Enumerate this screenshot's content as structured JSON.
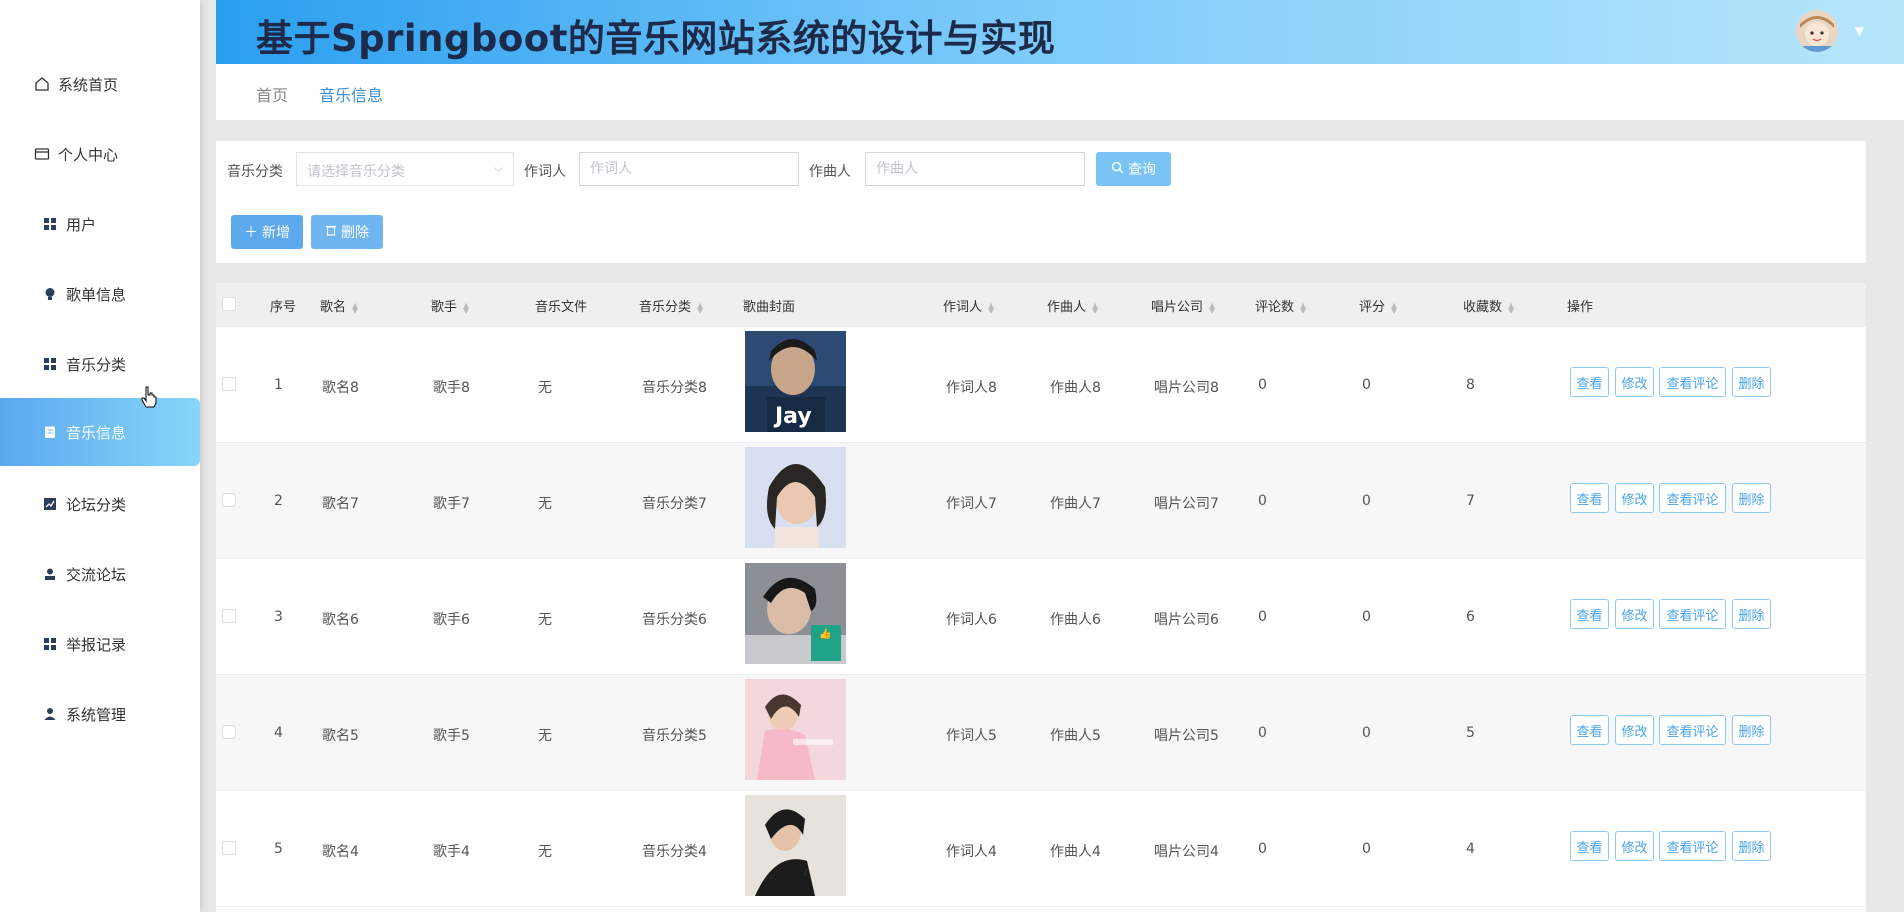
{
  "app": {
    "title": "基于Springboot的音乐网站系统的设计与实现"
  },
  "sidebar": {
    "items": [
      {
        "label": "系统首页",
        "icon": "home-icon"
      },
      {
        "label": "个人中心",
        "icon": "card-icon"
      },
      {
        "label": "用户",
        "icon": "grid-icon"
      },
      {
        "label": "歌单信息",
        "icon": "bulb-icon"
      },
      {
        "label": "音乐分类",
        "icon": "grid-icon"
      },
      {
        "label": "音乐信息",
        "icon": "clipboard-icon",
        "active": true
      },
      {
        "label": "论坛分类",
        "icon": "chart-icon"
      },
      {
        "label": "交流论坛",
        "icon": "user-icon"
      },
      {
        "label": "举报记录",
        "icon": "grid-icon"
      },
      {
        "label": "系统管理",
        "icon": "person-icon"
      }
    ]
  },
  "breadcrumb": {
    "home": "首页",
    "current": "音乐信息"
  },
  "search": {
    "category_label": "音乐分类",
    "category_placeholder": "请选择音乐分类",
    "lyricist_label": "作词人",
    "lyricist_placeholder": "作词人",
    "composer_label": "作曲人",
    "composer_placeholder": "作曲人",
    "search_button": "查询",
    "add_button": "新增",
    "delete_button": "删除"
  },
  "table": {
    "headers": {
      "index": "序号",
      "name": "歌名",
      "singer": "歌手",
      "file": "音乐文件",
      "category": "音乐分类",
      "cover": "歌曲封面",
      "lyricist": "作词人",
      "composer": "作曲人",
      "company": "唱片公司",
      "comments": "评论数",
      "rating": "评分",
      "favorites": "收藏数",
      "ops": "操作"
    },
    "actions": {
      "view": "查看",
      "edit": "修改",
      "view_comments": "查看评论",
      "delete": "删除"
    },
    "rows": [
      {
        "index": "1",
        "name": "歌名8",
        "singer": "歌手8",
        "file": "无",
        "category": "音乐分类8",
        "lyricist": "作词人8",
        "composer": "作曲人8",
        "company": "唱片公司8",
        "comments": "0",
        "rating": "0",
        "favorites": "8",
        "cover_text": "Jay"
      },
      {
        "index": "2",
        "name": "歌名7",
        "singer": "歌手7",
        "file": "无",
        "category": "音乐分类7",
        "lyricist": "作词人7",
        "composer": "作曲人7",
        "company": "唱片公司7",
        "comments": "0",
        "rating": "0",
        "favorites": "7",
        "cover_text": ""
      },
      {
        "index": "3",
        "name": "歌名6",
        "singer": "歌手6",
        "file": "无",
        "category": "音乐分类6",
        "lyricist": "作词人6",
        "composer": "作曲人6",
        "company": "唱片公司6",
        "comments": "0",
        "rating": "0",
        "favorites": "6",
        "cover_text": ""
      },
      {
        "index": "4",
        "name": "歌名5",
        "singer": "歌手5",
        "file": "无",
        "category": "音乐分类5",
        "lyricist": "作词人5",
        "composer": "作曲人5",
        "company": "唱片公司5",
        "comments": "0",
        "rating": "0",
        "favorites": "5",
        "cover_text": ""
      },
      {
        "index": "5",
        "name": "歌名4",
        "singer": "歌手4",
        "file": "无",
        "category": "音乐分类4",
        "lyricist": "作词人4",
        "composer": "作曲人4",
        "company": "唱片公司4",
        "comments": "0",
        "rating": "0",
        "favorites": "4",
        "cover_text": ""
      }
    ]
  }
}
